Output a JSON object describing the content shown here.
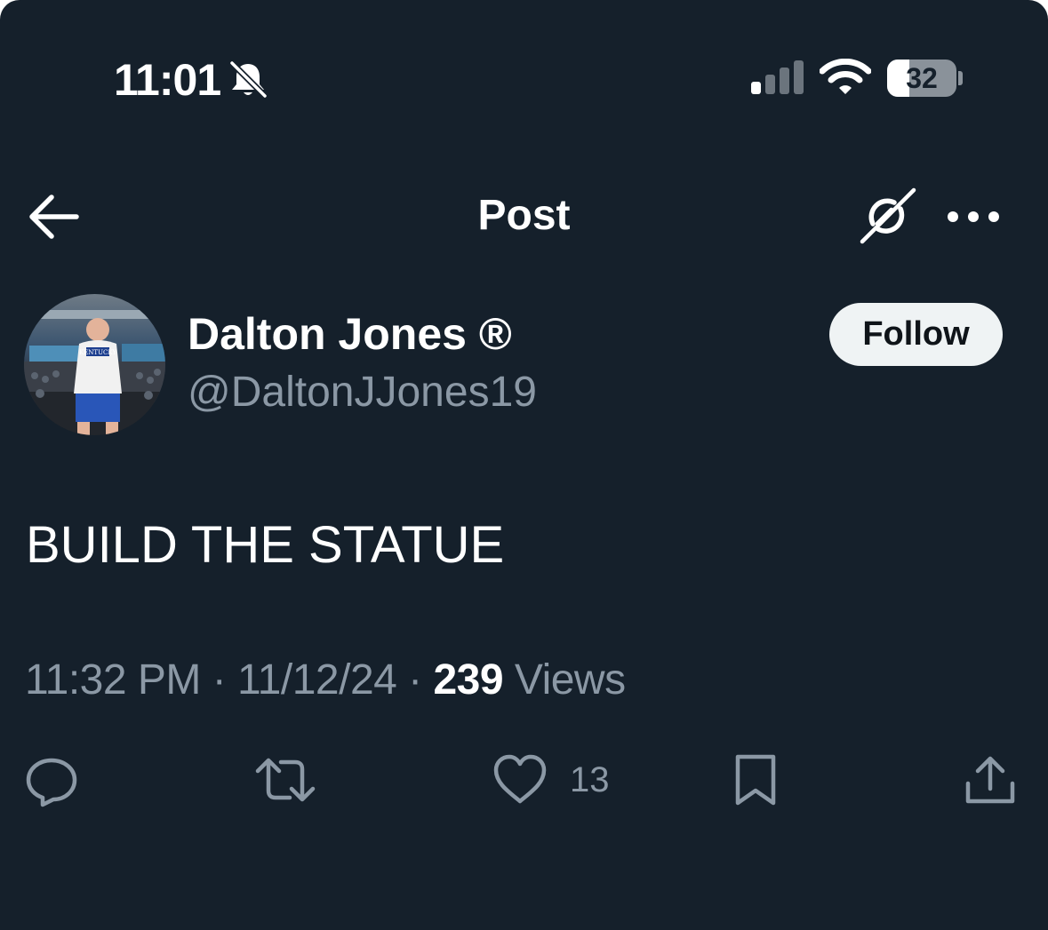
{
  "status_bar": {
    "time": "11:01",
    "battery_level": "32",
    "battery_fraction": 0.32,
    "icons": [
      "bell-off-icon",
      "cellular-signal-icon",
      "wifi-icon",
      "battery-icon"
    ]
  },
  "header": {
    "title": "Post",
    "icons": [
      "back-arrow-icon",
      "grok-icon",
      "more-icon"
    ]
  },
  "author": {
    "display_name": "Dalton Jones ®",
    "handle": "@DaltonJJones19",
    "follow_label": "Follow"
  },
  "post": {
    "text": "BUILD THE STATUE",
    "time": "11:32 PM",
    "date": "11/12/24",
    "separator": " · ",
    "views_count": "239",
    "views_label": " Views"
  },
  "actions": {
    "like_count": "13",
    "icons": [
      "reply-icon",
      "repost-icon",
      "like-icon",
      "bookmark-icon",
      "share-icon"
    ]
  },
  "colors": {
    "background": "#15202b",
    "primary_text": "#ffffff",
    "secondary_text": "#8b98a5",
    "follow_button_bg": "#eff3f4",
    "follow_button_text": "#0f1419"
  }
}
